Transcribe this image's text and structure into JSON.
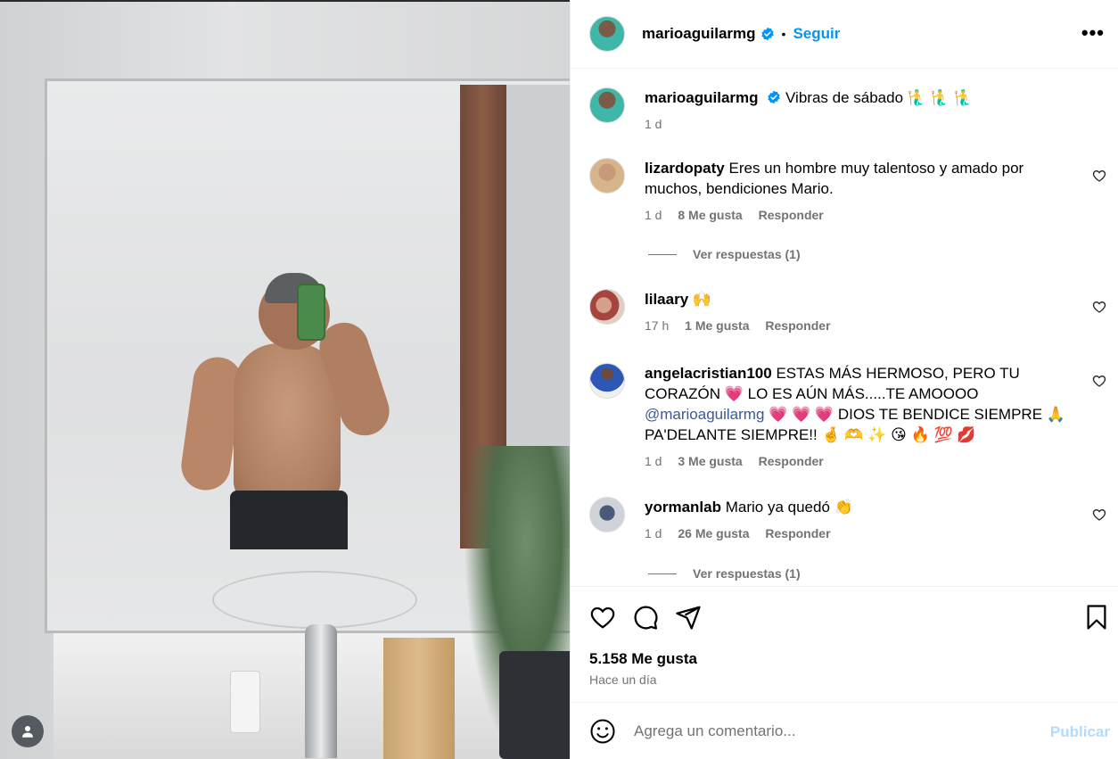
{
  "post": {
    "author": "marioaguilarmg",
    "follow_label": "Seguir",
    "separator": "•",
    "more_label": "•••"
  },
  "caption": {
    "user": "marioaguilarmg",
    "text": "Vibras de sábado 🧜‍♂️ 🧜‍♂️ 🧜‍♂️",
    "time": "1 d"
  },
  "comments": [
    {
      "user": "lizardopaty",
      "text": "Eres un hombre muy talentoso y amado por muchos, bendiciones Mario.",
      "time": "1 d",
      "likes": "8 Me gusta",
      "reply": "Responder"
    },
    {
      "user": "lilaary",
      "text": "🙌",
      "time": "17 h",
      "likes": "1 Me gusta",
      "reply": "Responder"
    },
    {
      "user": "angelacristian100",
      "text_before": "ESTAS MÁS HERMOSO, PERO TU CORAZÓN 💗 LO ES AÚN MÁS.....TE AMOOOO ",
      "mention": "@marioaguilarmg",
      "text_after": " 💗 💗 💗 DIOS TE BENDICE SIEMPRE 🙏 PA'DELANTE SIEMPRE!! 🤞 🫶 ✨ 😘 🔥 💯 💋",
      "time": "1 d",
      "likes": "3 Me gusta",
      "reply": "Responder"
    },
    {
      "user": "yormanlab",
      "text": "Mario ya quedó 👏",
      "time": "1 d",
      "likes": "26 Me gusta",
      "reply": "Responder"
    }
  ],
  "view_replies": [
    "Ver respuestas (1)",
    "Ver respuestas (1)"
  ],
  "footer": {
    "likes": "5.158 Me gusta",
    "posted": "Hace un día",
    "comment_placeholder": "Agrega un comentario...",
    "publish_label": "Publicar"
  },
  "colors": {
    "accent": "#0095f6",
    "publish_disabled": "#b3dbff",
    "muted": "#737373",
    "mention": "#00376b"
  },
  "icons": [
    "verified-badge-icon",
    "more-options-icon",
    "like-heart-icon",
    "comment-icon",
    "share-icon",
    "bookmark-icon",
    "emoji-icon",
    "user-avatar-icon"
  ]
}
